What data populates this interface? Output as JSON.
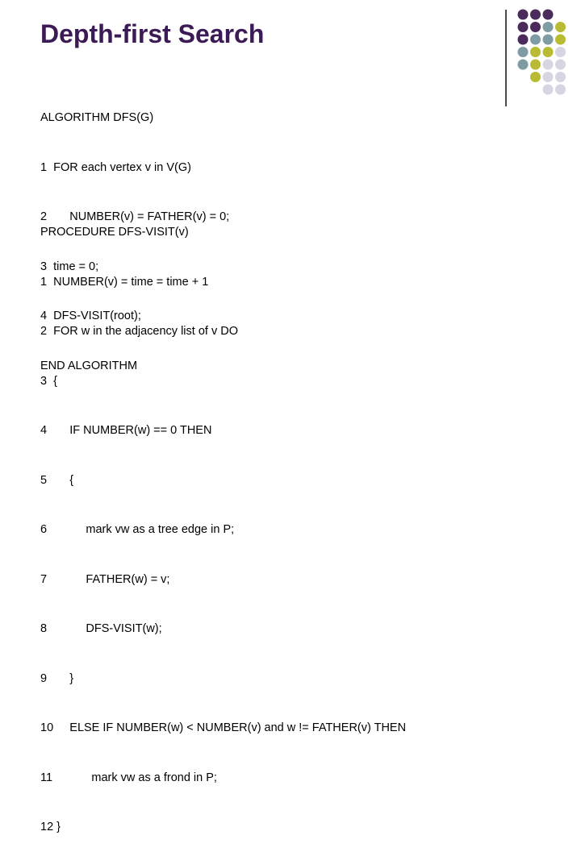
{
  "slide": {
    "title": "Depth-first Search",
    "decoration": {
      "colors": [
        "#4b2a5c",
        "#7f9ca4",
        "#b9bb33",
        "#d6d6e3"
      ],
      "rows": [
        [
          "purple",
          "purple",
          "purple"
        ],
        [
          "purple",
          "purple",
          "teal",
          "olive"
        ],
        [
          "purple",
          "teal",
          "teal",
          "olive"
        ],
        [
          "teal",
          "olive",
          "olive",
          "lavender"
        ],
        [
          "teal",
          "olive",
          "lavender",
          "lavender"
        ],
        [
          "olive",
          "lavender",
          "lavender"
        ],
        [
          "lavender",
          "lavender"
        ]
      ]
    }
  },
  "algorithm": {
    "lines": [
      "ALGORITHM DFS(G)",
      "1  FOR each vertex v in V(G)",
      "2       NUMBER(v) = FATHER(v) = 0;",
      "3  time = 0;",
      "4  DFS-VISIT(root);",
      "END ALGORITHM"
    ]
  },
  "procedure": {
    "lines": [
      "PROCEDURE DFS-VISIT(v)",
      "1  NUMBER(v) = time = time + 1",
      "2  FOR w in the adjacency list of v DO",
      "3  {",
      "4       IF NUMBER(w) == 0 THEN",
      "5       {",
      "6            mark vw as a tree edge in P;",
      "7            FATHER(w) = v;",
      "8            DFS-VISIT(w);",
      "9       }",
      "10     ELSE IF NUMBER(w) < NUMBER(v) and w != FATHER(v) THEN",
      "11            mark vw as a frond in P;",
      "12 }"
    ]
  }
}
